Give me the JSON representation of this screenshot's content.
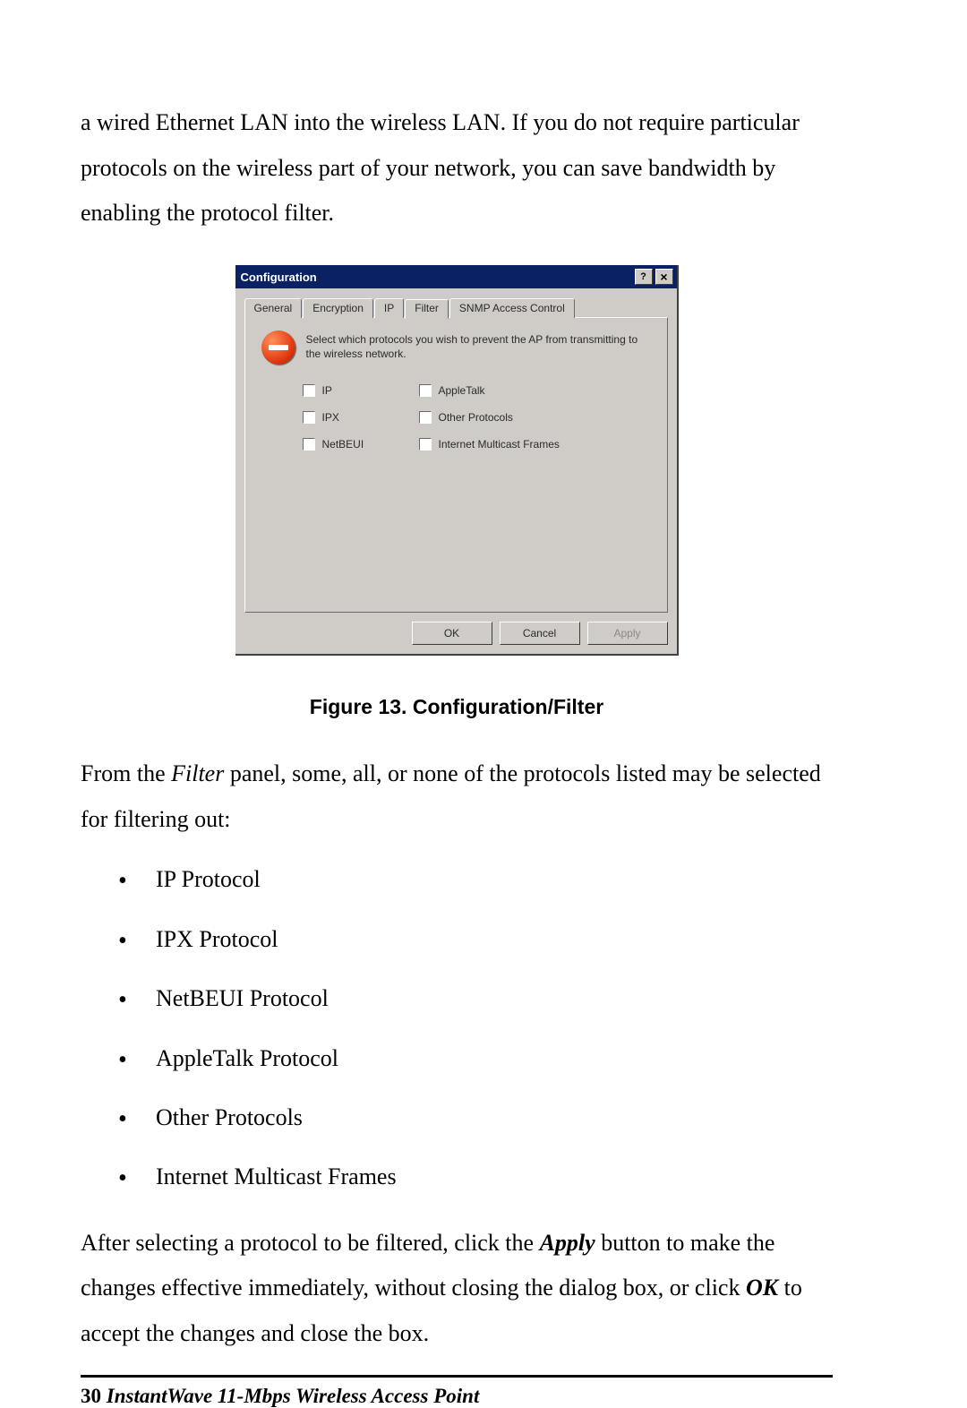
{
  "intro_paragraph": "a wired Ethernet LAN into the wireless LAN. If you do not require particular protocols on the wireless part of your network, you can save bandwidth by enabling the protocol filter.",
  "dialog": {
    "title": "Configuration",
    "tabs": {
      "general": "General",
      "encryption": "Encryption",
      "ip": "IP",
      "filter": "Filter",
      "snmp": "SNMP Access Control"
    },
    "info_text": "Select which protocols you wish to prevent the AP from transmitting to the wireless network.",
    "checks": {
      "ip": "IP",
      "appletalk": "AppleTalk",
      "ipx": "IPX",
      "other": "Other Protocols",
      "netbeui": "NetBEUI",
      "imf": "Internet Multicast Frames"
    },
    "buttons": {
      "ok": "OK",
      "cancel": "Cancel",
      "apply": "Apply"
    }
  },
  "figure_caption": "Figure 13.  Configuration/Filter",
  "after_figure_pre": "From the ",
  "after_figure_em": "Filter",
  "after_figure_post": " panel, some, all, or none of the protocols listed may be selected for filtering out:",
  "protocol_list": {
    "p1": "IP Protocol",
    "p2": "IPX Protocol",
    "p3": "NetBEUI Protocol",
    "p4": "AppleTalk Protocol",
    "p5": "Other Protocols",
    "p6": "Internet Multicast Frames"
  },
  "after_list_1a": "After selecting a protocol to be filtered, click the ",
  "after_list_1b": "Apply",
  "after_list_1c": " button to make the changes effective immediately, without closing the dialog box, or click ",
  "after_list_1d": "OK",
  "after_list_1e": " to accept the changes and close the box.",
  "footer": {
    "page": "30",
    "sep": "  ",
    "product": "InstantWave 11-Mbps Wireless Access Point"
  }
}
